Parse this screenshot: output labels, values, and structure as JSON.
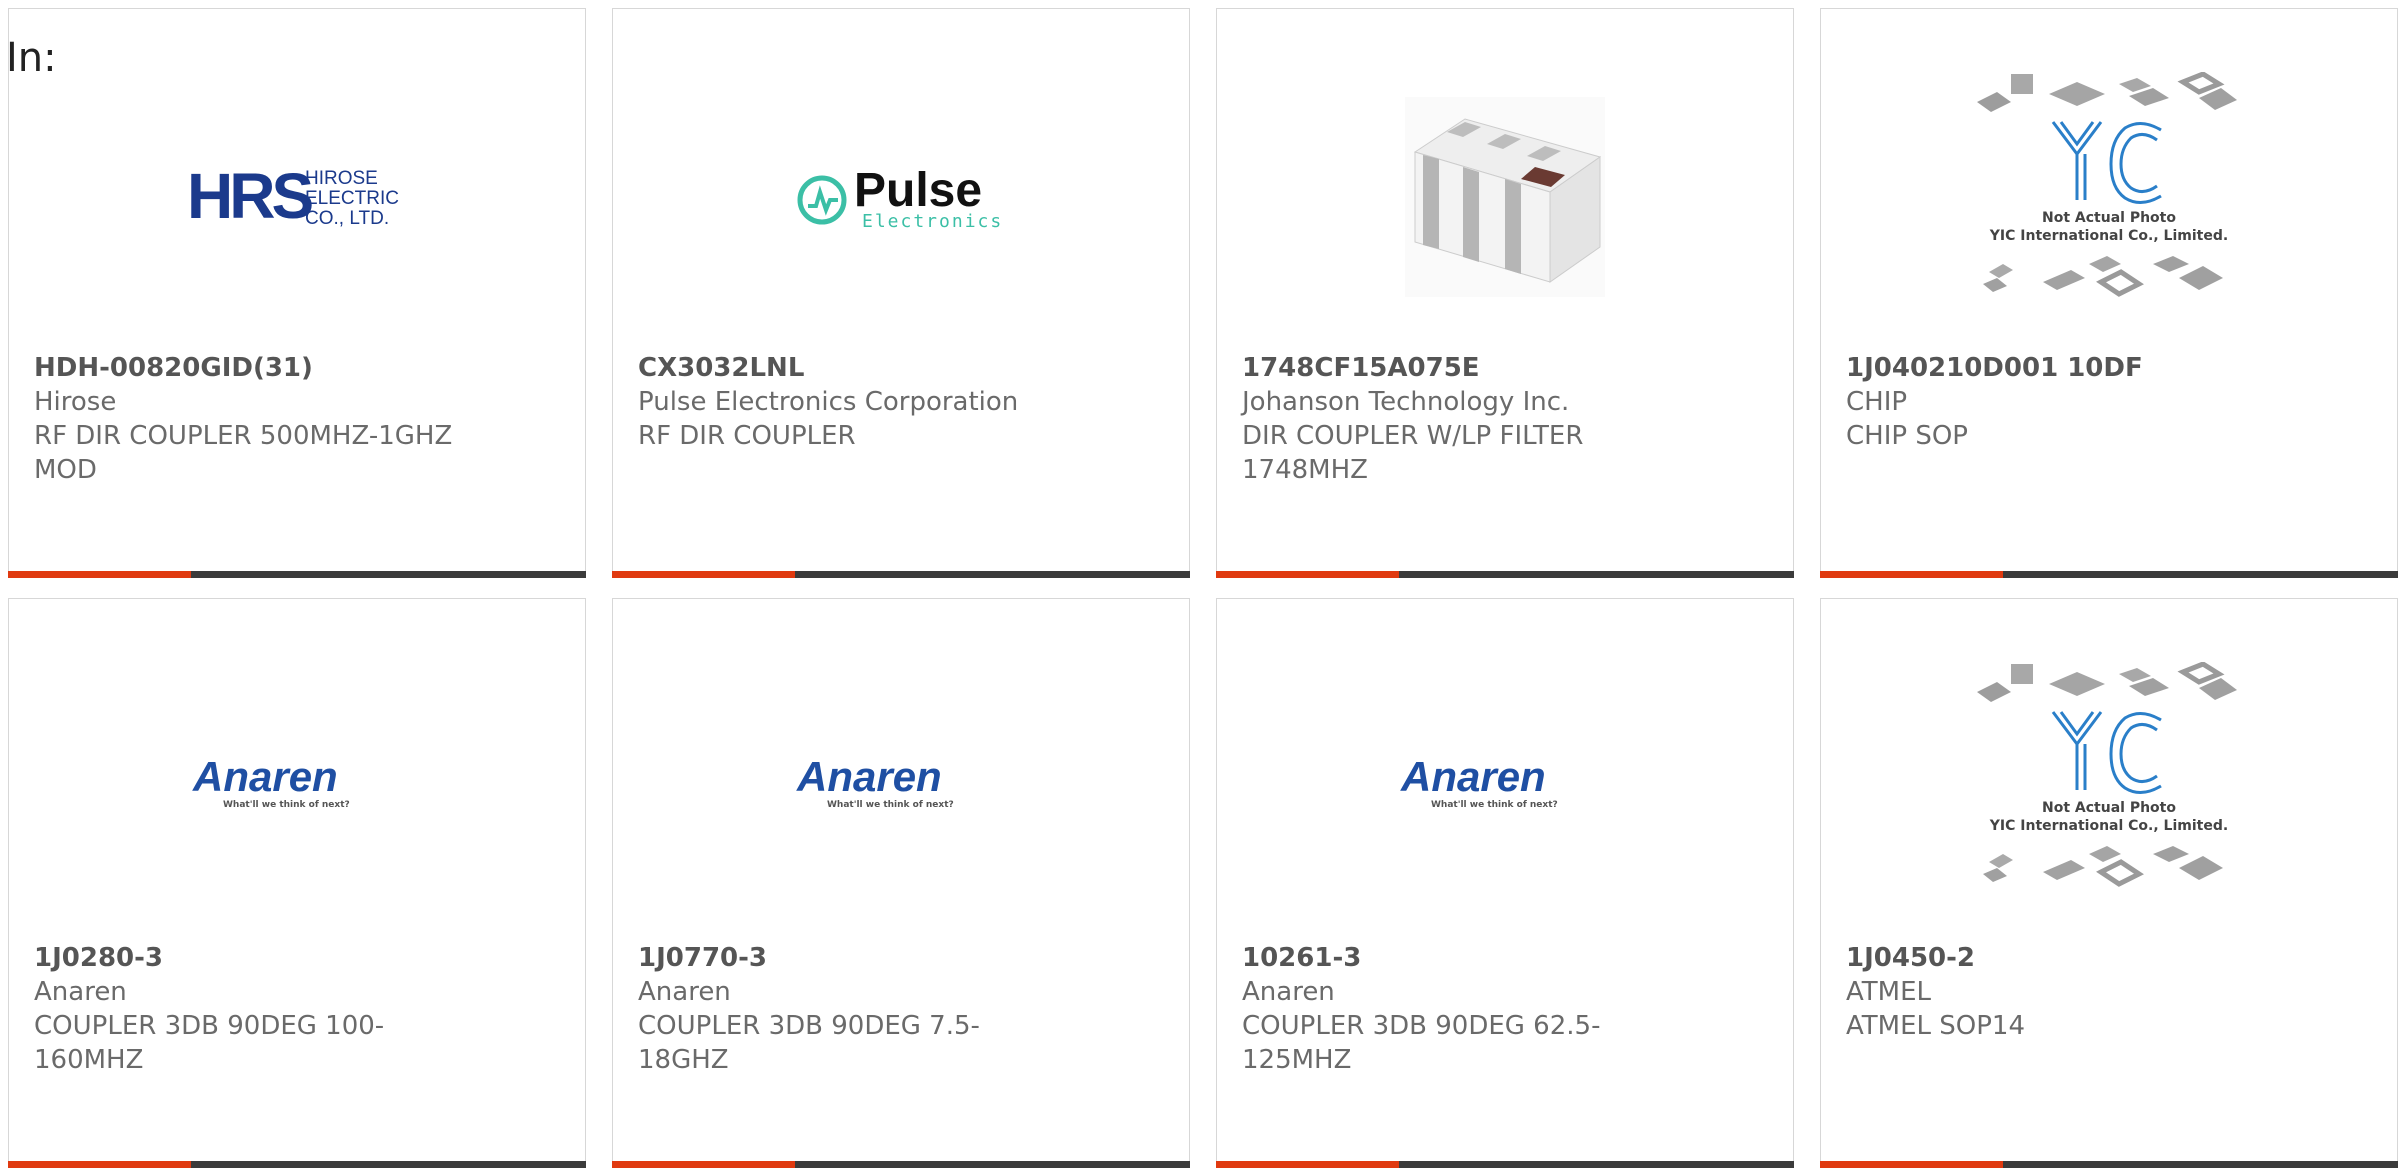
{
  "prefix_label": "In:",
  "colors": {
    "accent": "#e03a10",
    "bar_dark": "#3b3b3b",
    "hirose_blue": "#1b3a8c",
    "anaren_blue": "#1f4fa3",
    "pulse_teal": "#3bbfa6",
    "yic_blue": "#2a7fc9"
  },
  "products": [
    {
      "part_number": "HDH-00820GID(31)",
      "manufacturer": "Hirose",
      "description": "RF DIR COUPLER 500MHZ-1GHZ MOD",
      "image": "hirose-logo",
      "logo": {
        "brand": "HRS",
        "line1": "HIROSE",
        "line2": "ELECTRIC",
        "line3": "CO., LTD."
      }
    },
    {
      "part_number": "CX3032LNL",
      "manufacturer": "Pulse Electronics Corporation",
      "description": "RF DIR COUPLER",
      "image": "pulse-logo",
      "logo": {
        "brand": "Pulse",
        "sub": "Electronics"
      }
    },
    {
      "part_number": "1748CF15A075E",
      "manufacturer": "Johanson Technology Inc.",
      "description": "DIR COUPLER W/LP FILTER 1748MHZ",
      "image": "chip-photo"
    },
    {
      "part_number": "1J040210D001 10DF",
      "manufacturer": "CHIP",
      "description": "CHIP SOP",
      "image": "yic-placeholder",
      "logo": {
        "line1": "Not Actual Photo",
        "line2": "YIC International Co., Limited."
      }
    },
    {
      "part_number": "1J0280-3",
      "manufacturer": "Anaren",
      "description": "COUPLER 3DB 90DEG 100-160MHZ",
      "image": "anaren-logo",
      "logo": {
        "brand": "Anaren",
        "tagline": "What'll we think of next?"
      }
    },
    {
      "part_number": "1J0770-3",
      "manufacturer": "Anaren",
      "description": "COUPLER 3DB 90DEG 7.5-18GHZ",
      "image": "anaren-logo",
      "logo": {
        "brand": "Anaren",
        "tagline": "What'll we think of next?"
      }
    },
    {
      "part_number": "10261-3",
      "manufacturer": "Anaren",
      "description": "COUPLER 3DB 90DEG 62.5-125MHZ",
      "image": "anaren-logo",
      "logo": {
        "brand": "Anaren",
        "tagline": "What'll we think of next?"
      }
    },
    {
      "part_number": "1J0450-2",
      "manufacturer": "ATMEL",
      "description": "ATMEL SOP14",
      "image": "yic-placeholder",
      "logo": {
        "line1": "Not Actual Photo",
        "line2": "YIC International Co., Limited."
      }
    }
  ]
}
